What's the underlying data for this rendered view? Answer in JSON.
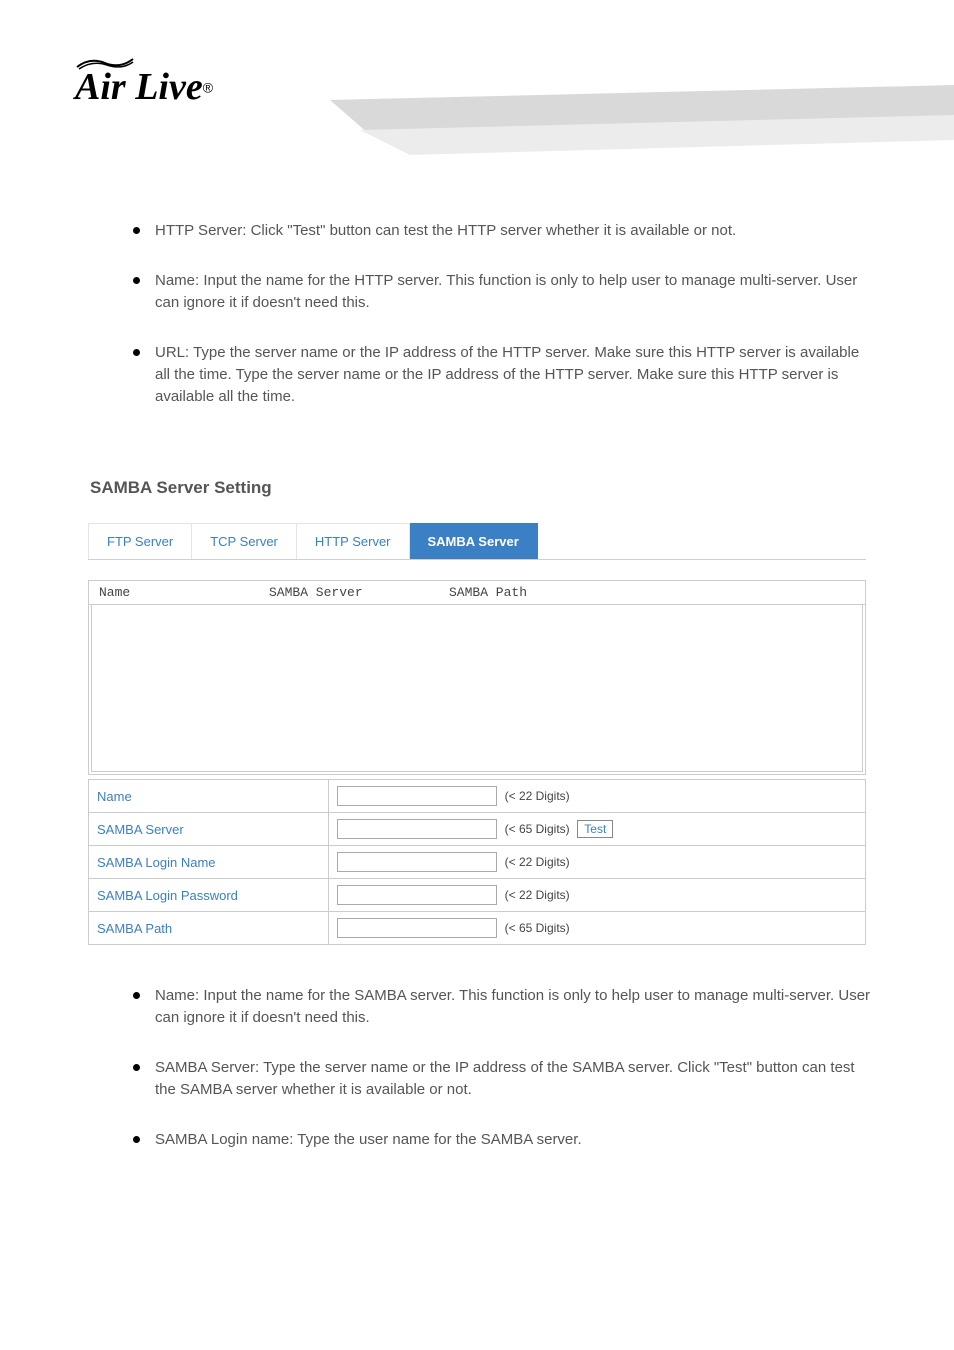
{
  "header": {
    "logo_text": "Air Live",
    "logo_r": "®"
  },
  "section1": {
    "bullets": [
      "HTTP Server: Click \"Test\" button can test the HTTP server whether it is available or not.",
      "Name: Input the name for the HTTP server. This function is only to help user to manage multi-server. User can ignore it if doesn't need this.",
      "URL: Type the server name or the IP address of the HTTP server. Make sure this HTTP server is available all the time. Type the server name or the IP address of the HTTP server. Make sure this HTTP server is available all the time."
    ]
  },
  "heading": "SAMBA Server Setting",
  "tabs": [
    {
      "label": "FTP Server",
      "active": false
    },
    {
      "label": "TCP Server",
      "active": false
    },
    {
      "label": "HTTP Server",
      "active": false
    },
    {
      "label": "SAMBA Server",
      "active": true
    }
  ],
  "list_header": {
    "col1": "Name",
    "col2": "SAMBA Server",
    "col3": "SAMBA Path"
  },
  "form": [
    {
      "label": "Name",
      "hint": "(< 22 Digits)",
      "test": false
    },
    {
      "label": "SAMBA Server",
      "hint": "(< 65 Digits)",
      "test": true,
      "test_label": "Test"
    },
    {
      "label": "SAMBA Login Name",
      "hint": "(< 22 Digits)",
      "test": false
    },
    {
      "label": "SAMBA Login Password",
      "hint": "(< 22 Digits)",
      "test": false
    },
    {
      "label": "SAMBA Path",
      "hint": "(< 65 Digits)",
      "test": false
    }
  ],
  "section2": {
    "bullets": [
      "Name: Input the name for the SAMBA server. This function is only to help user to manage multi-server. User can ignore it if doesn't need this.",
      "SAMBA Server: Type the server name or the IP address of the SAMBA server. Click \"Test\" button can test the SAMBA server whether it is available or not.",
      "SAMBA Login name: Type the user name for the SAMBA server."
    ]
  }
}
